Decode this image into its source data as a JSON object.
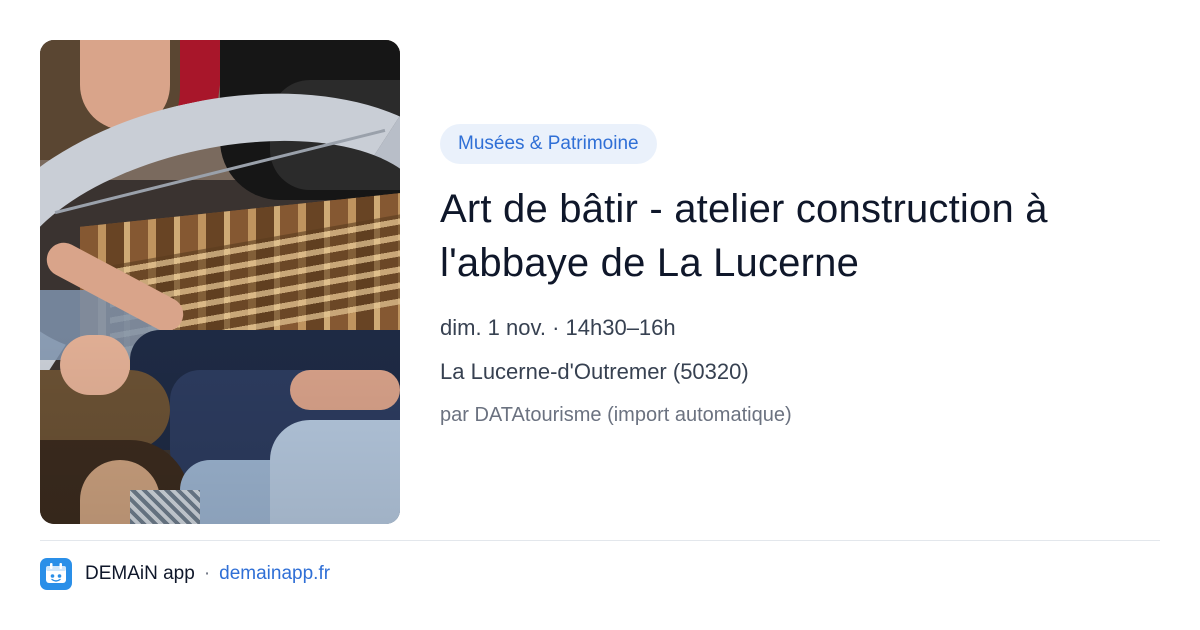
{
  "event": {
    "category": "Musées & Patrimoine",
    "title_lines": [
      "Art de bâtir - atelier construction à",
      "l'abbaye de La Lucerne"
    ],
    "datetime": "dim. 1 nov. · 14h30–16h",
    "location": "La Lucerne-d'Outremer (50320)",
    "source": "par DATAtourisme (import automatique)"
  },
  "footer": {
    "app_icon": "demain-app-icon",
    "app_name": "DEMAiN app",
    "separator": "·",
    "url": "demainapp.fr"
  },
  "colors": {
    "accent": "#2f6fd6",
    "pill_bg": "#eaf1fb",
    "title": "#0f172a",
    "meta": "#374151",
    "muted": "#6b7280",
    "divider": "#e3e7ec",
    "app_icon_bg": "#2a8fe8"
  }
}
